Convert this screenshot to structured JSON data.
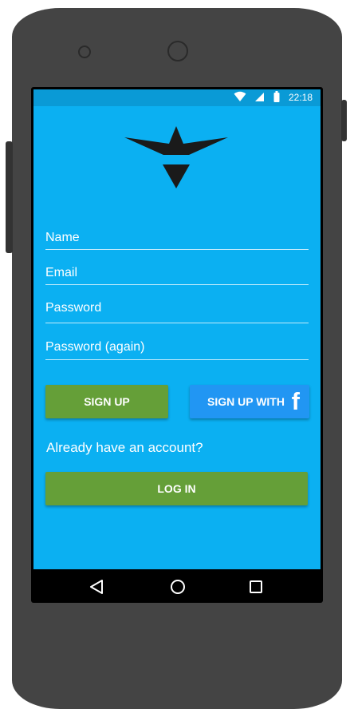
{
  "status_bar": {
    "time": "22:18",
    "icons": [
      "wifi-icon",
      "signal-icon",
      "battery-icon"
    ]
  },
  "logo": {
    "icon": "bird-logo-icon",
    "color": "#1a1a1a"
  },
  "form": {
    "name_placeholder": "Name",
    "email_placeholder": "Email",
    "password_placeholder": "Password",
    "password_again_placeholder": "Password (again)"
  },
  "buttons": {
    "sign_up": "SIGN UP",
    "sign_up_with": "SIGN UP WITH",
    "facebook_glyph": "f",
    "log_in": "LOG IN"
  },
  "already_account": "Already have an account?",
  "nav_bar": {
    "icons": [
      "back-icon",
      "home-icon",
      "recents-icon"
    ]
  },
  "colors": {
    "screen_bg": "#0bb0f2",
    "status_bar_bg": "#0a9ad6",
    "green_button": "#659f38",
    "facebook_button": "#2196f3",
    "phone_body": "#444444"
  }
}
